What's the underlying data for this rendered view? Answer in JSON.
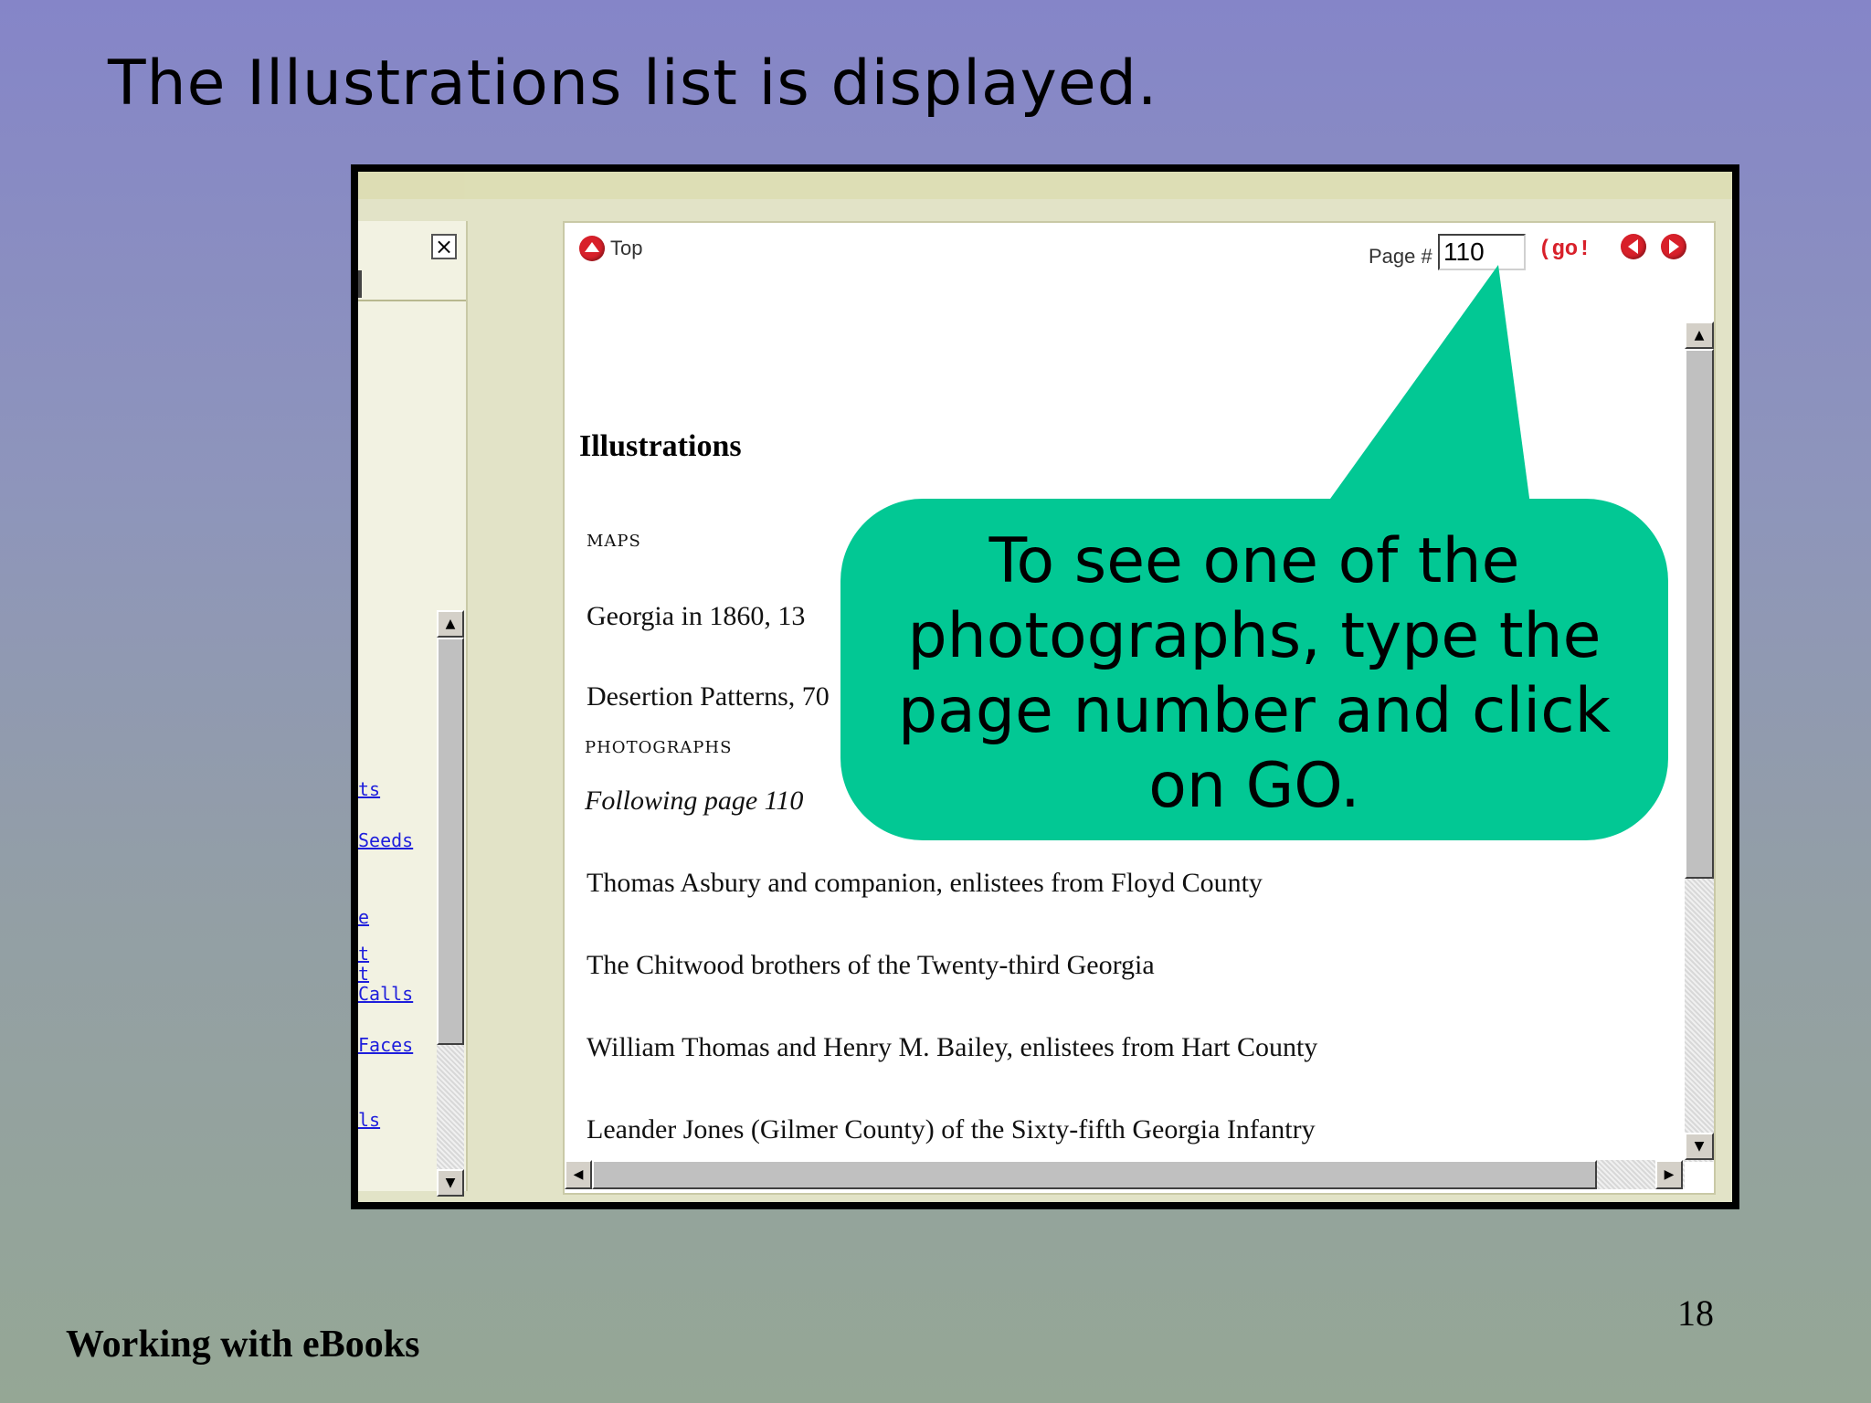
{
  "slide": {
    "title": "The Illustrations list is displayed.",
    "footer": "Working with eBooks",
    "page_number": "18"
  },
  "colors": {
    "callout": "#02c894",
    "link": "#1e1edc",
    "accent_red": "#d8202a"
  },
  "screenshot": {
    "side_panel": {
      "close_icon": "close-icon",
      "links": [
        "ts",
        "Seeds",
        "e",
        "t",
        "t",
        "Calls",
        "Faces",
        "ls"
      ]
    },
    "toolbar": {
      "top_label": "Top",
      "page_label": "Page #",
      "page_value": "110",
      "go_label": "(go!",
      "prev_icon": "arrow-left-icon",
      "next_icon": "arrow-right-icon"
    },
    "content": {
      "heading": "Illustrations",
      "maps_heading": "MAPS",
      "maps": [
        "Georgia in 1860, 13",
        "Desertion Patterns, 70"
      ],
      "photos_heading": "PHOTOGRAPHS",
      "photos_note": "Following page 110",
      "photos": [
        "Thomas Asbury and companion, enlistees from Floyd County",
        "The Chitwood brothers of the Twenty-third Georgia",
        "William Thomas and Henry M. Bailey, enlistees from Hart County",
        "Leander Jones (Gilmer County) of the Sixty-fifth Georgia Infantry"
      ]
    }
  },
  "callout": {
    "text_lines": [
      "To see one of the",
      "photographs, type the",
      "page number and click",
      "on GO."
    ]
  }
}
